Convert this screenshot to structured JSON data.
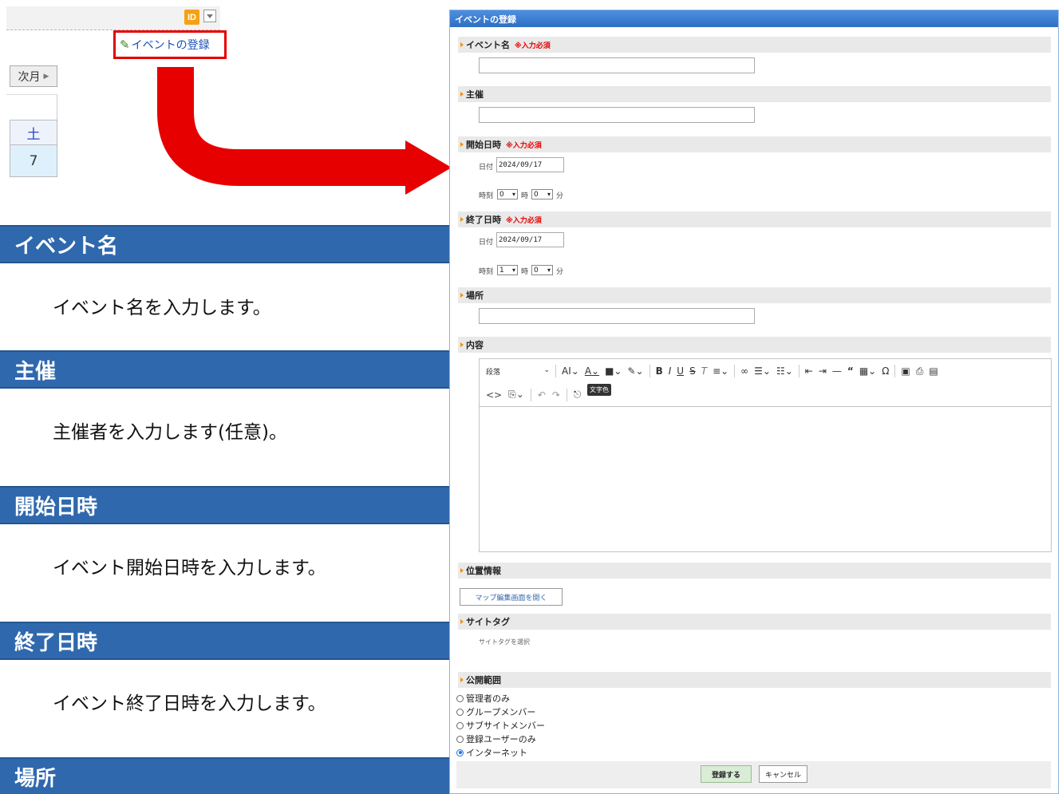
{
  "left": {
    "id_icon": "ID",
    "register_link": "イベントの登録",
    "next_month": "次月",
    "calendar": {
      "weekday": "土",
      "day": "7"
    },
    "sections": [
      {
        "title": "イベント名",
        "desc": "イベント名を入力します。"
      },
      {
        "title": "主催",
        "desc": "主催者を入力します(任意)。"
      },
      {
        "title": "開始日時",
        "desc": "イベント開始日時を入力します。"
      },
      {
        "title": "終了日時",
        "desc": "イベント終了日時を入力します。"
      },
      {
        "title": "場所",
        "desc": ""
      }
    ]
  },
  "form": {
    "title": "イベントの登録",
    "required_mark": "※入力必須",
    "fields": {
      "event_name": "イベント名",
      "organizer": "主催",
      "start": "開始日時",
      "end": "終了日時",
      "place": "場所",
      "content": "内容",
      "location": "位置情報",
      "site_tag": "サイトタグ",
      "scope": "公開範囲"
    },
    "date_label": "日付",
    "time_label": "時刻",
    "hour_label": "時",
    "minute_label": "分",
    "start_date": "2024/09/17",
    "start_hour": "0",
    "start_min": "0",
    "end_date": "2024/09/17",
    "end_hour": "1",
    "end_min": "0",
    "editor": {
      "paragraph": "段落",
      "tooltip": "文字色"
    },
    "map_button": "マップ編集画面を開く",
    "site_tag_hint": "サイトタグを選択",
    "scope_options": [
      "管理者のみ",
      "グループメンバー",
      "サブサイトメンバー",
      "登録ユーザーのみ",
      "インターネット"
    ],
    "scope_selected": 4,
    "submit": "登録する",
    "cancel": "キャンセル"
  },
  "colors": {
    "section_header": "#2f68ad",
    "arrow": "#e60000",
    "required": "#e60000"
  }
}
